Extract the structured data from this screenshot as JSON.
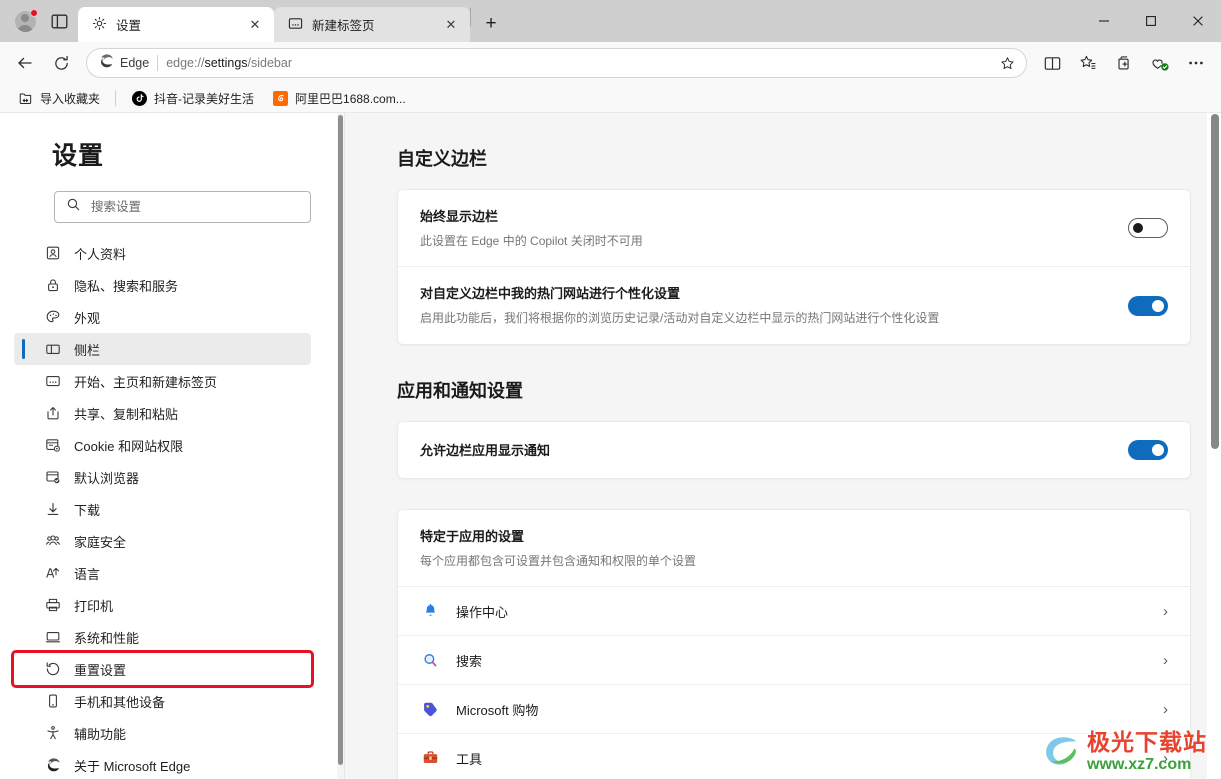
{
  "window": {
    "minimize_label": "—",
    "maximize_label": "□",
    "close_label": "✕"
  },
  "tabbar": {
    "profile_icon": "avatar-icon",
    "split_screen_icon": "split-screen-icon",
    "new_tab_label": "+",
    "tabs": [
      {
        "title": "设置",
        "icon": "gear-icon",
        "active": true,
        "close_label": "✕"
      },
      {
        "title": "新建标签页",
        "icon": "newtab-icon",
        "active": false,
        "close_label": "✕"
      }
    ]
  },
  "toolbar": {
    "back_icon": "back-arrow-icon",
    "reload_icon": "reload-icon",
    "edge_label": "Edge",
    "url_scheme": "edge://",
    "url_bold": "settings",
    "url_rest": "/sidebar",
    "url_full": "edge://settings/sidebar",
    "favorite_icon": "star-icon",
    "split_icon": "split-screen-icon",
    "collections_icon": "favorites-star-icon",
    "add_collection_icon": "collections-icon",
    "browser_essentials_icon": "browser-essentials-icon",
    "more_icon": "more-options-icon"
  },
  "bookmarks": {
    "import_label": "导入收藏夹",
    "items": [
      {
        "label": "抖音-记录美好生活",
        "icon": "tiktok-icon"
      },
      {
        "label": "阿里巴巴1688.com...",
        "icon": "alibaba-icon"
      }
    ]
  },
  "sidebar": {
    "title": "设置",
    "search": {
      "placeholder": "搜索设置",
      "value": "",
      "icon": "search-icon"
    },
    "items": [
      {
        "label": "个人资料",
        "icon": "profile-icon",
        "active": false,
        "highlight": false
      },
      {
        "label": "隐私、搜索和服务",
        "icon": "lock-icon",
        "active": false,
        "highlight": false
      },
      {
        "label": "外观",
        "icon": "palette-icon",
        "active": false,
        "highlight": false
      },
      {
        "label": "侧栏",
        "icon": "sidebar-icon",
        "active": true,
        "highlight": false
      },
      {
        "label": "开始、主页和新建标签页",
        "icon": "home-icon",
        "active": false,
        "highlight": false
      },
      {
        "label": "共享、复制和粘贴",
        "icon": "share-icon",
        "active": false,
        "highlight": false
      },
      {
        "label": "Cookie 和网站权限",
        "icon": "cookie-icon",
        "active": false,
        "highlight": false
      },
      {
        "label": "默认浏览器",
        "icon": "default-browser-icon",
        "active": false,
        "highlight": false
      },
      {
        "label": "下载",
        "icon": "download-icon",
        "active": false,
        "highlight": false
      },
      {
        "label": "家庭安全",
        "icon": "family-icon",
        "active": false,
        "highlight": false
      },
      {
        "label": "语言",
        "icon": "language-icon",
        "active": false,
        "highlight": false
      },
      {
        "label": "打印机",
        "icon": "printer-icon",
        "active": false,
        "highlight": false
      },
      {
        "label": "系统和性能",
        "icon": "system-icon",
        "active": false,
        "highlight": false
      },
      {
        "label": "重置设置",
        "icon": "reset-icon",
        "active": false,
        "highlight": true
      },
      {
        "label": "手机和其他设备",
        "icon": "phone-icon",
        "active": false,
        "highlight": false
      },
      {
        "label": "辅助功能",
        "icon": "accessibility-icon",
        "active": false,
        "highlight": false
      },
      {
        "label": "关于 Microsoft Edge",
        "icon": "edge-logo-icon",
        "active": false,
        "highlight": false
      }
    ]
  },
  "main": {
    "section1": {
      "title": "自定义边栏",
      "rows": [
        {
          "title": "始终显示边栏",
          "sub": "此设置在 Edge 中的 Copilot 关闭时不可用",
          "toggle": "off"
        },
        {
          "title": "对自定义边栏中我的热门网站进行个性化设置",
          "sub": "启用此功能后，我们将根据你的浏览历史记录/活动对自定义边栏中显示的热门网站进行个性化设置",
          "toggle": "on"
        }
      ]
    },
    "section2": {
      "title": "应用和通知设置",
      "allow_row": {
        "title": "允许边栏应用显示通知",
        "toggle": "on"
      },
      "app_specific": {
        "title": "特定于应用的设置",
        "sub": "每个应用都包含可设置并包含通知和权限的单个设置"
      },
      "apps": [
        {
          "name": "操作中心",
          "icon": "bell-icon",
          "chevron": "›"
        },
        {
          "name": "搜索",
          "icon": "search-magnifier-icon",
          "chevron": "›"
        },
        {
          "name": "Microsoft 购物",
          "icon": "shopping-tag-icon",
          "chevron": "›"
        },
        {
          "name": "工具",
          "icon": "toolbox-icon",
          "chevron": "›"
        }
      ]
    }
  },
  "watermark": {
    "top": "极光下载站",
    "bottom": "www.xz7.com"
  },
  "colors": {
    "accent": "#0f6cbd",
    "highlight": "#e81123",
    "titlebar": "#cfcfcf",
    "main_bg": "#f5f5f5"
  }
}
